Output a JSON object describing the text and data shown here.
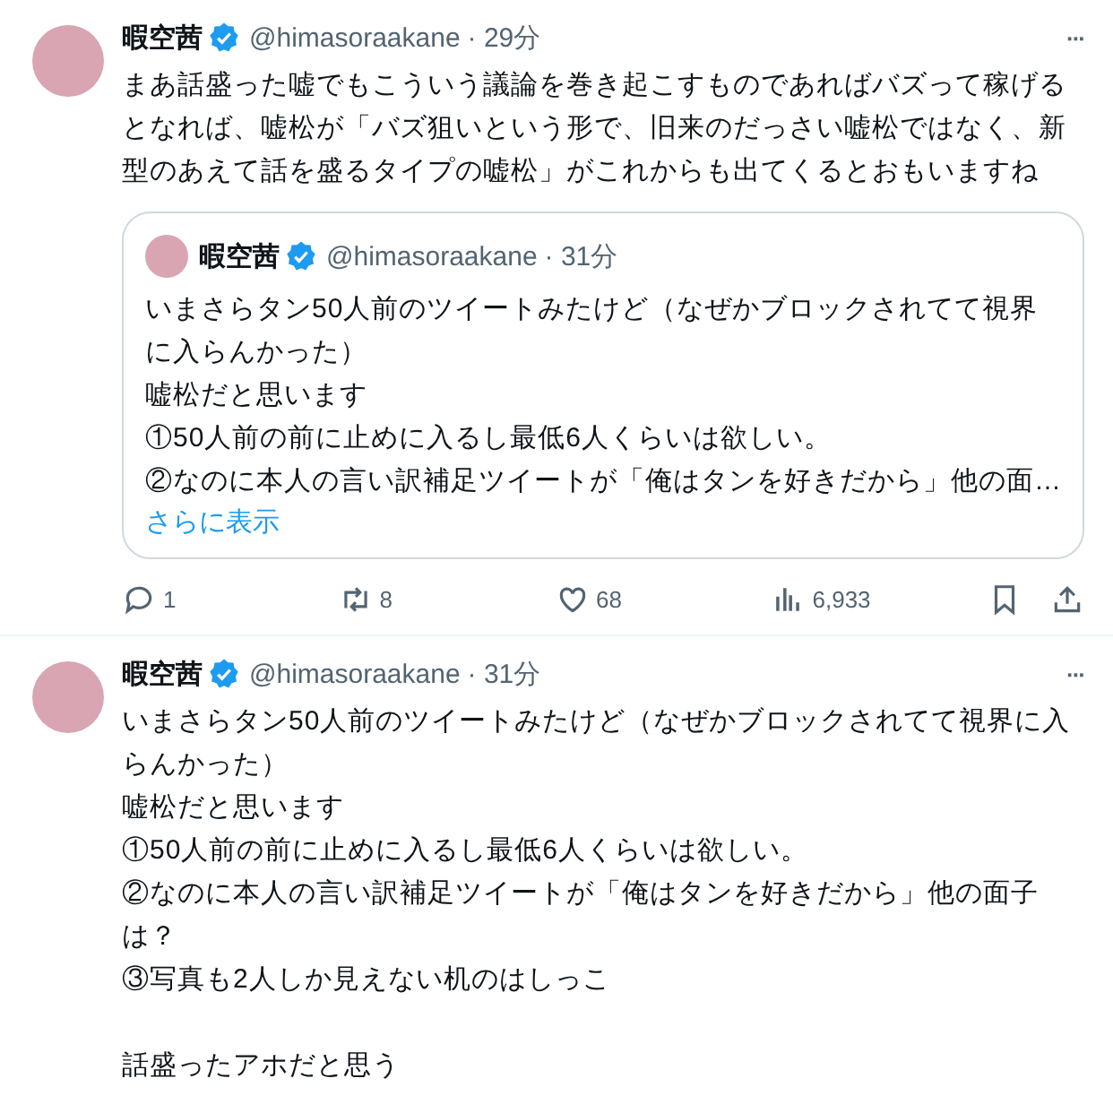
{
  "tweets": [
    {
      "name": "暇空茜",
      "verified": true,
      "handle": "@himasoraakane",
      "time": "· 29分",
      "more": "···",
      "paragraphs": [
        {
          "text": "まあ話盛った嘘でもこういう議論を巻き起こすものであればバズって稼げるとなれば、嘘松が「バズ狙いという形で、旧来のだっさい嘘松ではなく、新型のあえて話を盛るタイプの嘘松」がこれからも出てくるとおもいますね",
          "spaced_before": false
        }
      ],
      "quote": {
        "name": "暇空茜",
        "verified": true,
        "handle": "@himasoraakane",
        "time": "· 31分",
        "paragraphs": [
          {
            "text": "いまさらタン50人前のツイートみたけど（なぜかブロックされてて視界に入らんかった）",
            "spaced_before": false
          },
          {
            "text": "嘘松だと思います",
            "spaced_before": false
          },
          {
            "text": "①50人前の前に止めに入るし最低6人くらいは欲しい。",
            "spaced_before": false
          },
          {
            "text": "②なのに本人の言い訳補足ツイートが「俺はタンを好きだから」他の面…",
            "spaced_before": false
          }
        ],
        "show_more": "さらに表示"
      },
      "actions": [
        {
          "kind": "reply",
          "count": "1"
        },
        {
          "kind": "retweet",
          "count": "8"
        },
        {
          "kind": "like",
          "count": "68"
        },
        {
          "kind": "views",
          "count": "6,933"
        },
        {
          "kind": "bookmark"
        },
        {
          "kind": "share"
        }
      ]
    },
    {
      "name": "暇空茜",
      "verified": true,
      "handle": "@himasoraakane",
      "time": "· 31分",
      "more": "···",
      "paragraphs": [
        {
          "text": "いまさらタン50人前のツイートみたけど（なぜかブロックされてて視界に入らんかった）",
          "spaced_before": false
        },
        {
          "text": "嘘松だと思います",
          "spaced_before": false
        },
        {
          "text": "①50人前の前に止めに入るし最低6人くらいは欲しい。",
          "spaced_before": false
        },
        {
          "text": "②なのに本人の言い訳補足ツイートが「俺はタンを好きだから」他の面子は？",
          "spaced_before": false
        },
        {
          "text": "③写真も2人しか見えない机のはしっこ",
          "spaced_before": false
        },
        {
          "text": "話盛ったアホだと思う",
          "spaced_before": true
        }
      ]
    }
  ]
}
